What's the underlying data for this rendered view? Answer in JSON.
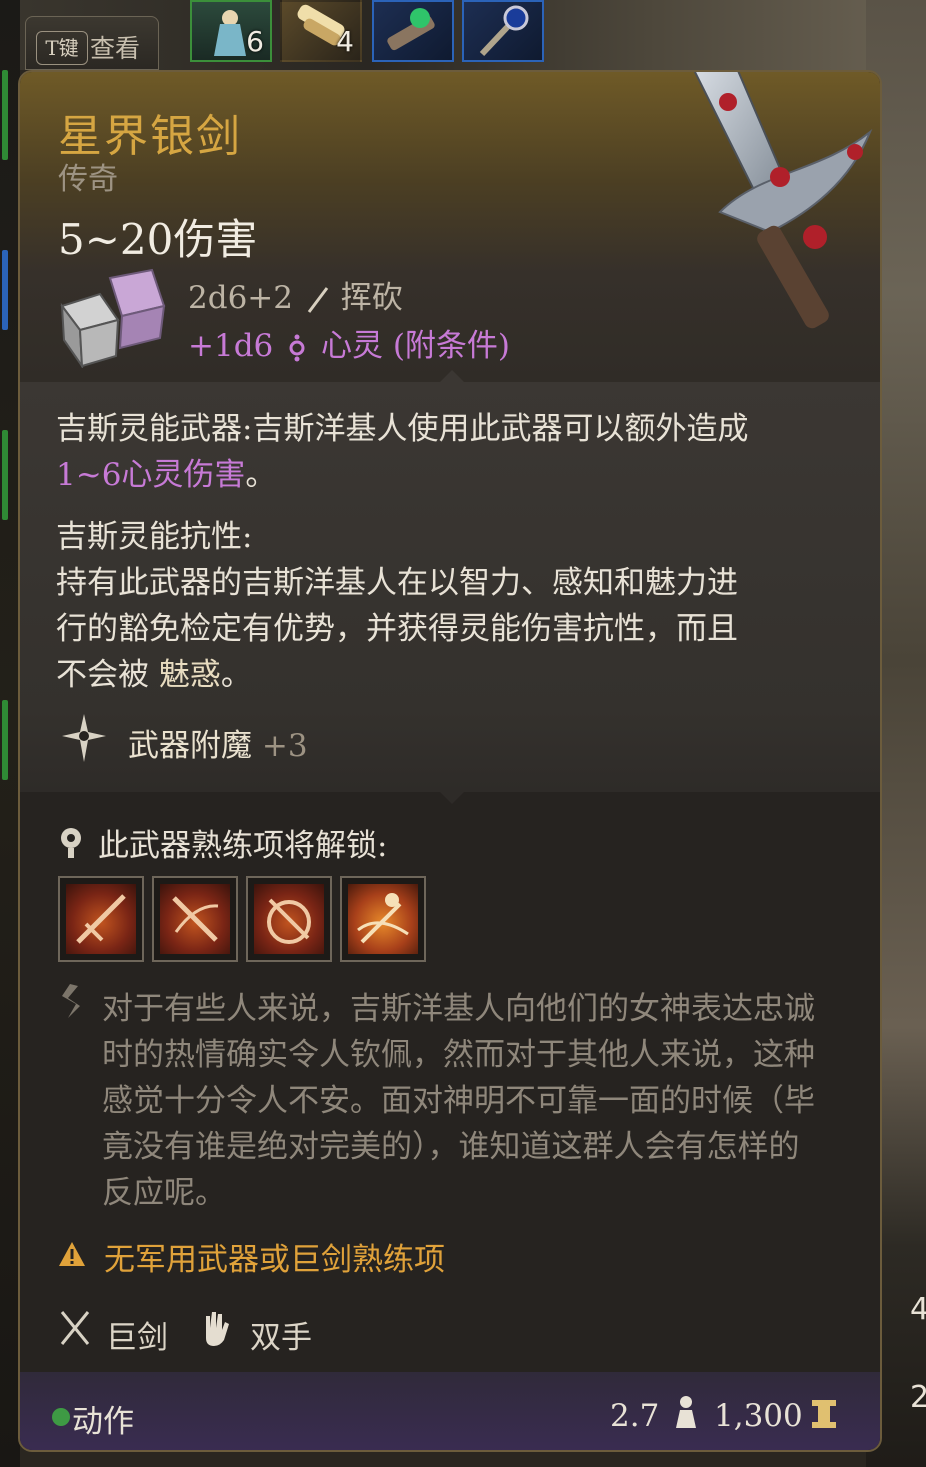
{
  "hotbar": {
    "toggle_key": "T键",
    "toggle_label": "查看",
    "slots": [
      {
        "icon": "figurine-icon",
        "count": "6",
        "border": "#3b8f3a"
      },
      {
        "icon": "scroll-icon",
        "count": "4",
        "border": "#3b8f3a"
      },
      {
        "icon": "green-gem-icon",
        "count": "",
        "border": "#2b63b8"
      },
      {
        "icon": "staff-icon",
        "count": "",
        "border": "#2b63b8"
      }
    ]
  },
  "item": {
    "name": "星界银剑",
    "rarity": "传奇",
    "damage": "5~20伤害",
    "damage_lines": [
      {
        "dice": "2d6+2",
        "icon": "slash-icon",
        "type": "挥砍"
      },
      {
        "dice": "+1d6",
        "icon": "psychic-icon",
        "type": "心灵 (附条件)"
      }
    ],
    "colors": {
      "name": "#d6a642",
      "psychic": "#c77ad6",
      "warning": "#e0a23a"
    }
  },
  "passives": [
    {
      "title": "吉斯灵能武器:",
      "text_line1": "吉斯洋基人使用此武器可以额外造成",
      "text_line2_highlight": "1~6心灵伤害",
      "text_line2_end": "。"
    },
    {
      "title": "吉斯灵能抗性:",
      "line1": "持有此武器的吉斯洋基人在以智力、感知和魅力进",
      "line2": "行的豁免检定有优势，并获得灵能伤害抗性，而且",
      "line3_a": "不会被",
      "line3_b": "魅惑",
      "line3_c": "。"
    }
  ],
  "enchantment": {
    "icon": "enchant-icon",
    "label": "武器附魔",
    "value": "+3"
  },
  "proficiency": {
    "label": "此武器熟练项将解锁:",
    "skills": [
      {
        "icon": "skill-rush-icon"
      },
      {
        "icon": "skill-slash-icon"
      },
      {
        "icon": "skill-cleave-icon"
      },
      {
        "icon": "skill-lacerate-icon"
      }
    ]
  },
  "flavor": [
    "对于有些人来说，吉斯洋基人向他们的女神表达忠诚",
    "时的热情确实令人钦佩，然而对于其他人来说，这种",
    "感觉十分令人不安。面对神明不可靠一面的时候（毕",
    "竟没有谁是绝对完美的），谁知道这群人会有怎样的",
    "反应呢。"
  ],
  "warning": "无军用武器或巨剑熟练项",
  "properties": [
    {
      "icon": "crossed-swords-icon",
      "label": "巨剑"
    },
    {
      "icon": "hand-icon",
      "label": "双手"
    }
  ],
  "footer": {
    "action_label": "动作",
    "weight": "2.7",
    "value": "1,300"
  },
  "side_numbers": [
    "4",
    "2"
  ]
}
